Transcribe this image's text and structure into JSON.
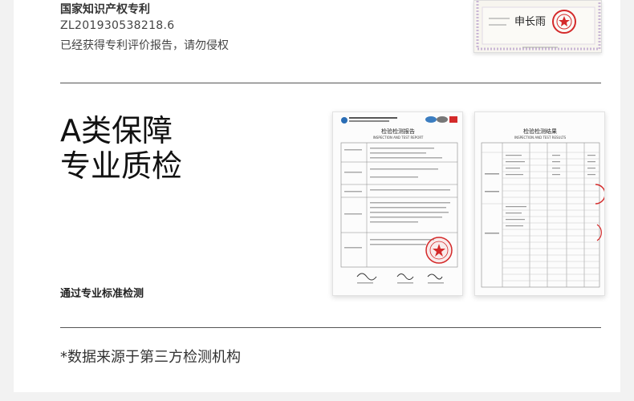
{
  "patent": {
    "title": "国家知识产权专利",
    "number": "ZL201930538218.6",
    "note": "已经获得专利评价报告，请勿侵权"
  },
  "certificate": {
    "icon": "certificate-image",
    "signature": "申长雨"
  },
  "headline": {
    "line1": "A类保障",
    "line2": "专业质检"
  },
  "subline": "通过专业标准检测",
  "reports": {
    "report1_title": "检验检测报告",
    "report1_subtitle": "INSPECTION AND TEST REPORT",
    "report2_title": "检验检测结果",
    "report2_subtitle": "INSPECTION AND TEST RESULTS"
  },
  "footnote": "*数据来源于第三方检测机构",
  "colors": {
    "background": "#f2f2f2",
    "card": "#ffffff",
    "stamp_red": "#d42a2a",
    "divider": "#555555"
  }
}
